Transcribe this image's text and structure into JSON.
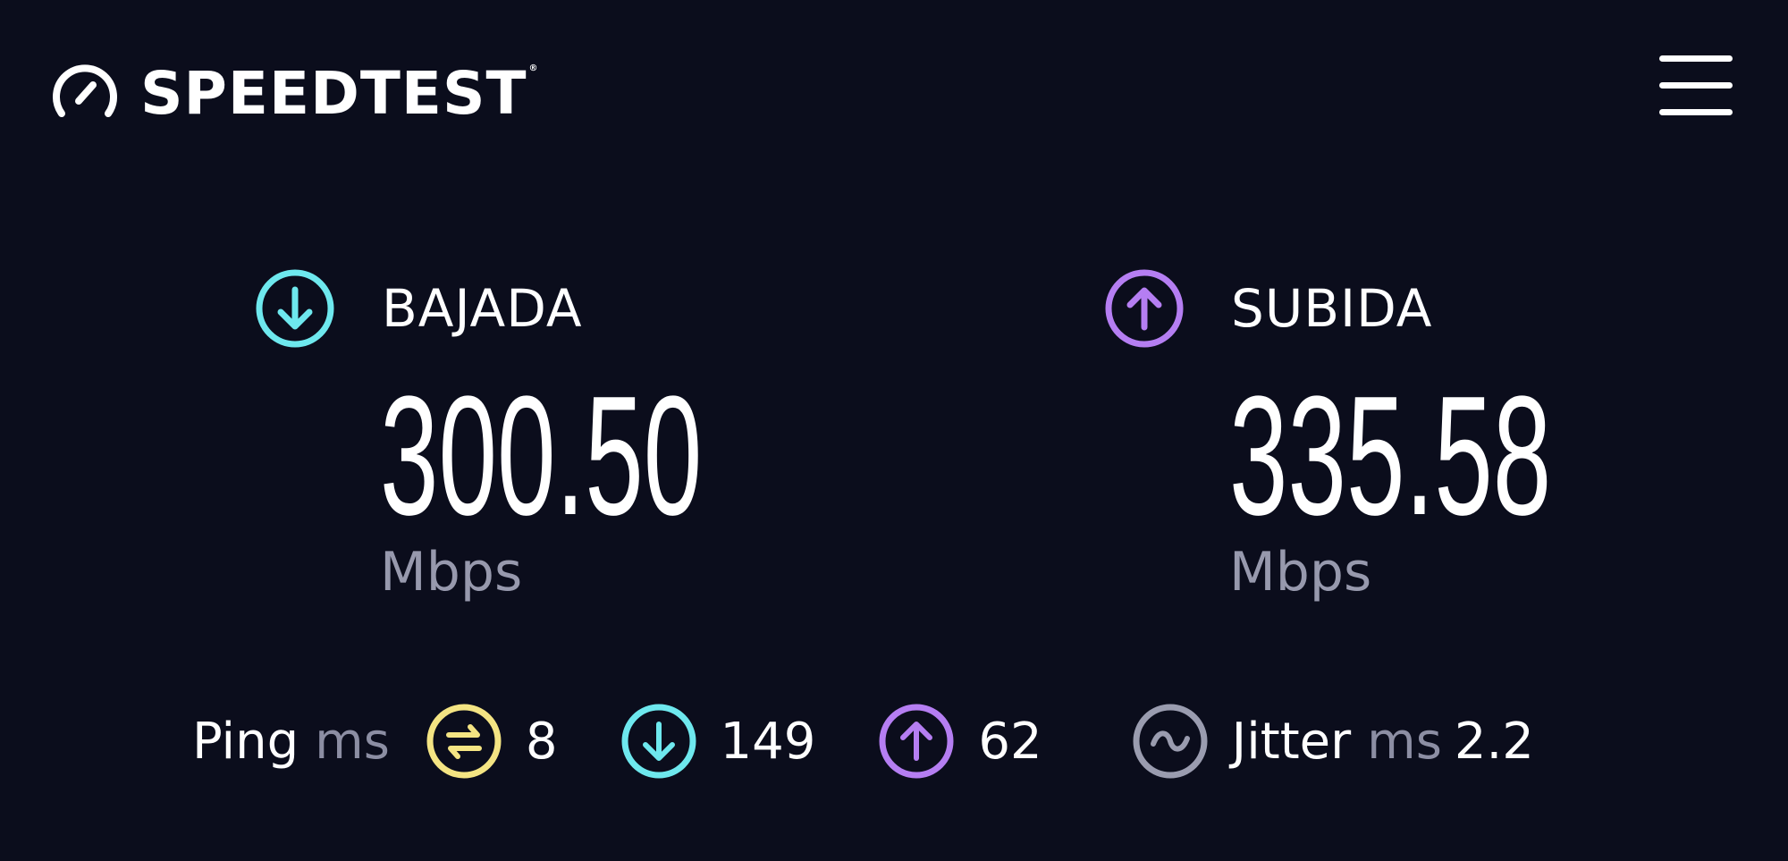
{
  "app": {
    "brand": "SPEEDTEST",
    "trademark": "®",
    "menu_icon": "hamburger-menu-icon"
  },
  "colors": {
    "background": "#0b0d1c",
    "download_accent": "#6ee8ee",
    "upload_accent": "#b57ef2",
    "ping_accent": "#f4e483",
    "jitter_accent": "#9a9caf",
    "unit_text": "#9799ad"
  },
  "download": {
    "label": "BAJADA",
    "value": "300.50",
    "unit": "Mbps",
    "icon": "download-arrow-icon"
  },
  "upload": {
    "label": "SUBIDA",
    "value": "335.58",
    "unit": "Mbps",
    "icon": "upload-arrow-icon"
  },
  "stats": {
    "ping_label": "Ping",
    "ping_unit": "ms",
    "idle_ping": "8",
    "download_ping": "149",
    "upload_ping": "62",
    "jitter_label": "Jitter",
    "jitter_unit": "ms",
    "jitter_value": "2.2"
  }
}
